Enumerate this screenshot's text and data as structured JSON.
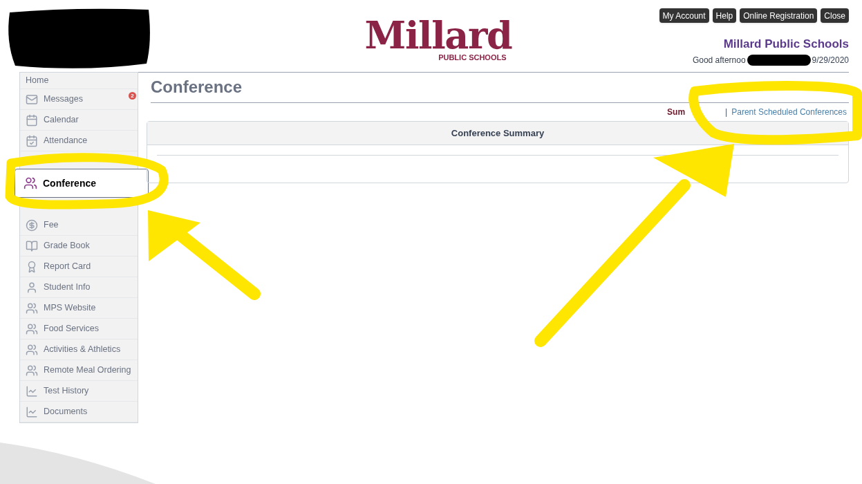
{
  "header": {
    "buttons": [
      "My Account",
      "Help",
      "Online Registration",
      "Close"
    ],
    "logo": {
      "name": "Millard",
      "tagline": "PUBLIC SCHOOLS"
    },
    "district": "Millard Public Schools",
    "greeting": "Good afternoo",
    "date": "9/29/2020"
  },
  "sidebar": {
    "items": [
      {
        "label": "Home",
        "kind": "plain",
        "selected": false
      },
      {
        "label": "Messages",
        "kind": "messages",
        "badge": "2",
        "selected": false
      },
      {
        "label": "Calendar",
        "kind": "calendar",
        "selected": false
      },
      {
        "label": "Attendance",
        "kind": "attendance",
        "selected": false
      },
      {
        "label": "Conference",
        "kind": "conference",
        "selected": true
      },
      {
        "label": "Fee",
        "kind": "fee",
        "selected": false
      },
      {
        "label": "Grade Book",
        "kind": "gradebook",
        "selected": false
      },
      {
        "label": "Report Card",
        "kind": "reportcard",
        "selected": false
      },
      {
        "label": "Student Info",
        "kind": "student",
        "selected": false
      },
      {
        "label": "MPS Website",
        "kind": "group",
        "selected": false
      },
      {
        "label": "Food Services",
        "kind": "group",
        "selected": false
      },
      {
        "label": "Activities & Athletics",
        "kind": "group",
        "selected": false
      },
      {
        "label": "Remote Meal Ordering",
        "kind": "group",
        "selected": false
      },
      {
        "label": "Test History",
        "kind": "chart",
        "selected": false
      },
      {
        "label": "Documents",
        "kind": "chart",
        "selected": false
      }
    ]
  },
  "page": {
    "title": "Conference",
    "links": [
      {
        "label": "Sum",
        "selected": true
      },
      {
        "label": "Parent Scheduled Conferences",
        "selected": false
      }
    ],
    "separator": "|",
    "panel": {
      "title": "Conference Summary"
    }
  }
}
